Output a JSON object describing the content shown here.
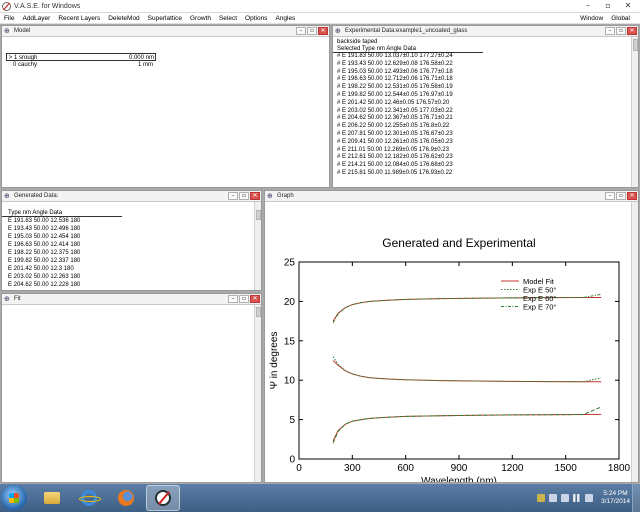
{
  "app": {
    "title": "V.A.S.E. for Windows",
    "controls": {
      "minimize": "–",
      "maximize": "▫",
      "close": "✕"
    }
  },
  "menu": {
    "items": [
      "File",
      "AddLayer",
      "Recent Layers",
      "DeleteMod",
      "Superlattice",
      "Growth",
      "Select",
      "Options",
      "Angles"
    ],
    "right_items": [
      "Window",
      "Global"
    ]
  },
  "model_window": {
    "title": "Model",
    "layers": [
      {
        "marker": ">",
        "label": "1 srough",
        "value": "0.000 nm"
      },
      {
        "marker": "",
        "label": "0 cauchy",
        "value": "1 mm"
      }
    ]
  },
  "exp_window": {
    "title": "Experimental Data:example1_uncoated_glass",
    "subtitle": "backside taped",
    "header": "Selected Type  nm  Angle  Data",
    "rows": [
      "# E  191.83  50.00  13.037±0.10  177.27±0.24",
      "# E  193.43  50.00  12.629±0.08  176.58±0.22",
      "# E  195.03  50.00  12.493±0.06  176.77±0.18",
      "# E  196.63  50.00  12.712±0.06  176.71±0.18",
      "# E  198.22  50.00  12.531±0.05  176.58±0.19",
      "# E  199.82  50.00  12.544±0.05  176.97±0.19",
      "# E  201.42  50.00  12.46±0.05  176.57±0.20",
      "# E  203.02  50.00  12.341±0.05  177.03±0.22",
      "# E  204.62  50.00  12.367±0.05  176.71±0.21",
      "# E  206.22  50.00  12.255±0.05  176.8±0.22",
      "# E  207.81  50.00  12.301±0.05  176.67±0.23",
      "# E  209.41  50.00  12.261±0.05  176.05±0.23",
      "# E  211.01  50.00  12.269±0.05  176.9±0.23",
      "# E  212.61  50.00  12.182±0.05  176.62±0.23",
      "# E  214.21  50.00  12.084±0.05  176.68±0.23",
      "# E  215.81  50.00  11.989±0.05  176.93±0.22"
    ]
  },
  "gen_window": {
    "title": "Generated Data:",
    "header": "Type  nm  Angle  Data",
    "rows": [
      "E  191.83  50.00  12.536  180",
      "E  193.43  50.00  12.496  180",
      "E  195.03  50.00  12.454  180",
      "E  196.63  50.00  12.414  180",
      "E  198.22  50.00  12.375  180",
      "E  199.82  50.00  12.337  180",
      "E  201.42  50.00  12.3  180",
      "E  203.02  50.00  12.263  180",
      "E  204.62  50.00  12.228  180"
    ]
  },
  "fit_window": {
    "title": "Fit"
  },
  "graph_window": {
    "title": "Graph"
  },
  "chart_data": {
    "type": "line",
    "title": "Generated and Experimental",
    "xlabel": "Wavelength (nm)",
    "ylabel": "Ψ in degrees",
    "xlim": [
      0,
      1800
    ],
    "ylim": [
      0,
      25
    ],
    "xticks": [
      0,
      300,
      600,
      900,
      1200,
      1500,
      1800
    ],
    "yticks": [
      0,
      5,
      10,
      15,
      20,
      25
    ],
    "grid": false,
    "legend_position": "top-right",
    "legend": [
      "Model Fit",
      "Exp E 50°",
      "Exp E 60°",
      "Exp E 70°"
    ],
    "x": [
      192,
      220,
      260,
      300,
      350,
      400,
      500,
      600,
      800,
      1000,
      1200,
      1400,
      1600,
      1700
    ],
    "series": [
      {
        "name": "Model Fit",
        "group": "50",
        "values": [
          12.5,
          11.9,
          11.2,
          10.8,
          10.5,
          10.3,
          10.15,
          10.05,
          9.95,
          9.9,
          9.85,
          9.82,
          9.8,
          9.8
        ]
      },
      {
        "name": "Model Fit",
        "group": "60",
        "values": [
          2.3,
          3.6,
          4.4,
          4.8,
          5.0,
          5.15,
          5.3,
          5.4,
          5.5,
          5.55,
          5.6,
          5.62,
          5.65,
          5.66
        ]
      },
      {
        "name": "Model Fit",
        "group": "70",
        "values": [
          17.5,
          18.5,
          19.2,
          19.6,
          19.85,
          20.0,
          20.15,
          20.25,
          20.35,
          20.4,
          20.45,
          20.48,
          20.5,
          20.5
        ]
      },
      {
        "name": "Exp E 50°",
        "values": [
          13.0,
          12.0,
          11.2,
          10.8,
          10.5,
          10.3,
          10.15,
          10.05,
          9.95,
          9.9,
          9.85,
          9.82,
          9.8,
          10.3
        ]
      },
      {
        "name": "Exp E 60°",
        "values": [
          2.0,
          3.5,
          4.4,
          4.8,
          5.0,
          5.15,
          5.3,
          5.4,
          5.5,
          5.55,
          5.6,
          5.62,
          5.65,
          6.6
        ]
      },
      {
        "name": "Exp E 70°",
        "values": [
          17.3,
          18.4,
          19.2,
          19.6,
          19.85,
          20.0,
          20.15,
          20.25,
          20.35,
          20.4,
          20.45,
          20.48,
          20.5,
          20.9
        ]
      }
    ],
    "colors": {
      "model": "#c0392b",
      "exp": "#2e7d32",
      "axis": "#000000"
    }
  },
  "taskbar": {
    "apps": [
      "folder-icon",
      "ie-icon",
      "firefox-icon",
      "vase-icon"
    ],
    "time": "5:24 PM",
    "date": "3/17/2014"
  }
}
